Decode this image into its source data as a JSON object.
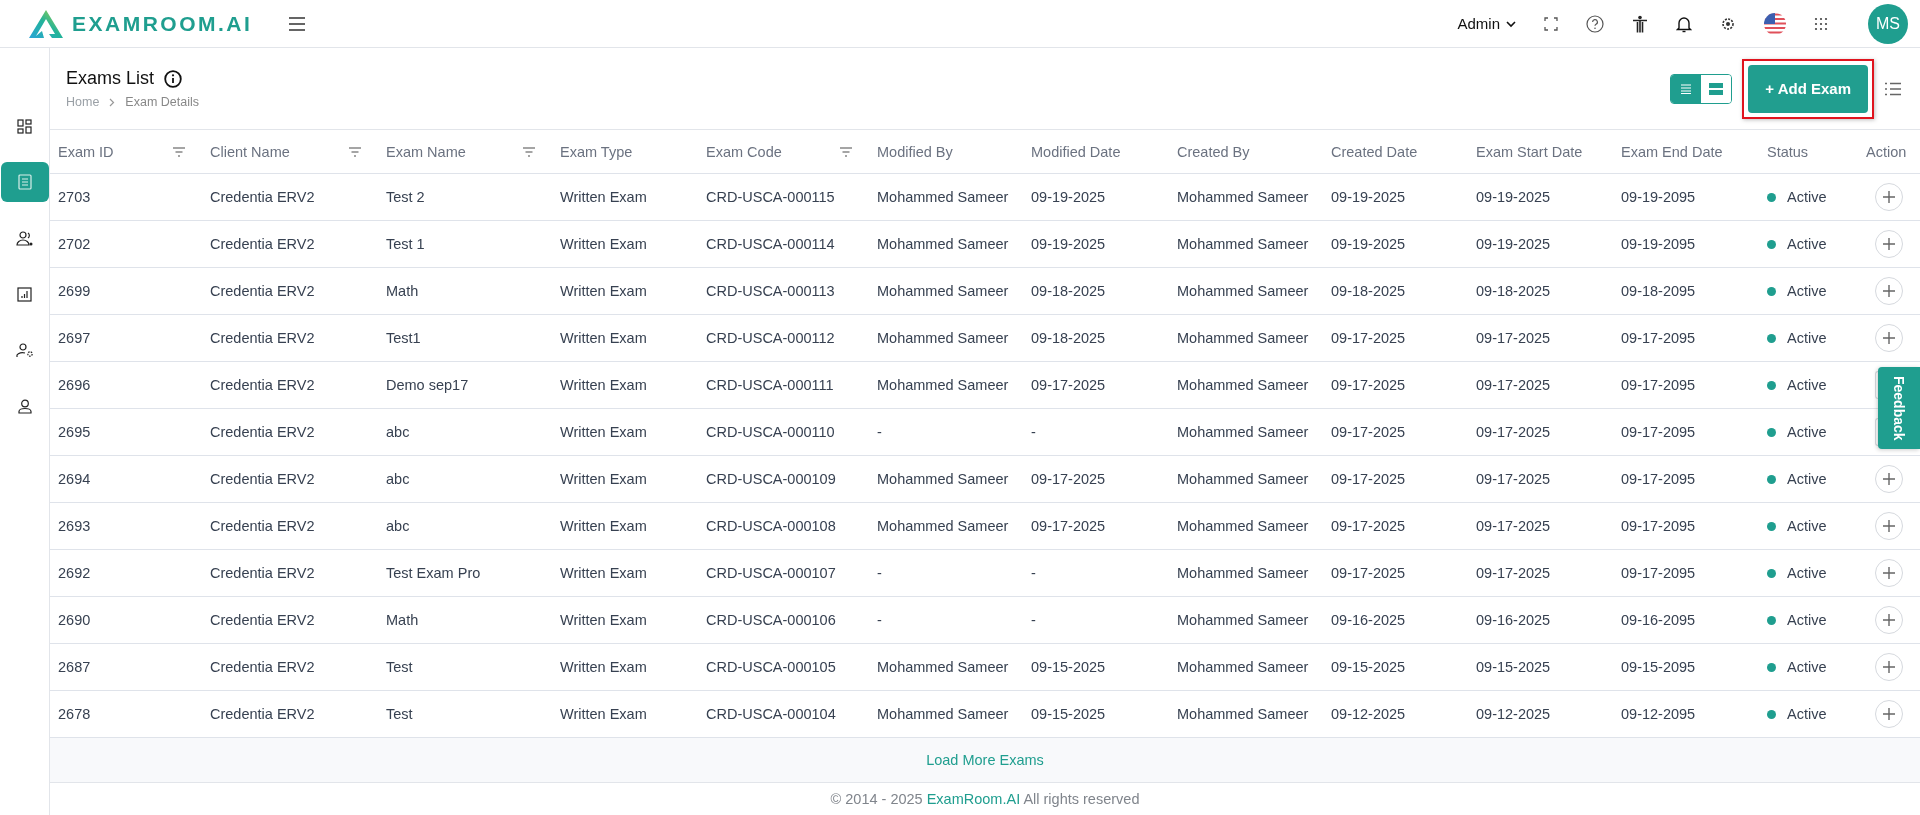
{
  "header": {
    "logo_text": "EXAMROOM.AI",
    "role": "Admin",
    "avatar": "MS"
  },
  "sidebar": {
    "items": [
      {
        "kind": "dashboard",
        "selected": false
      },
      {
        "kind": "exams",
        "selected": true
      },
      {
        "kind": "candidates",
        "selected": false
      },
      {
        "kind": "reports",
        "selected": false
      },
      {
        "kind": "user-settings",
        "selected": false
      },
      {
        "kind": "profile",
        "selected": false
      }
    ]
  },
  "page": {
    "title": "Exams List",
    "breadcrumb": [
      "Home",
      "Exam Details"
    ],
    "view_toggle": [
      {
        "kind": "list",
        "selected": true
      },
      {
        "kind": "cards",
        "selected": false
      }
    ],
    "add_button": {
      "label": "+ Add Exam",
      "highlighted": true
    }
  },
  "table": {
    "columns": [
      {
        "label": "Exam ID",
        "filter": true
      },
      {
        "label": "Client Name",
        "filter": true
      },
      {
        "label": "Exam Name",
        "filter": true
      },
      {
        "label": "Exam Type",
        "filter": false
      },
      {
        "label": "Exam Code",
        "filter": true
      },
      {
        "label": "Modified By",
        "filter": false
      },
      {
        "label": "Modified Date",
        "filter": false
      },
      {
        "label": "Created By",
        "filter": false
      },
      {
        "label": "Created Date",
        "filter": false
      },
      {
        "label": "Exam Start Date",
        "filter": false
      },
      {
        "label": "Exam End Date",
        "filter": false
      },
      {
        "label": "Status",
        "filter": false
      },
      {
        "label": "Action",
        "filter": false
      }
    ],
    "rows": [
      {
        "cells": [
          "2703",
          "Credentia ERV2",
          "Test 2",
          "Written Exam",
          "CRD-USCA-000115",
          "Mohammed Sameer",
          "09-19-2025",
          "Mohammed Sameer",
          "09-19-2025",
          "09-19-2025",
          "09-19-2095"
        ],
        "status": "Active",
        "color": "#1f9e8f"
      },
      {
        "cells": [
          "2702",
          "Credentia ERV2",
          "Test 1",
          "Written Exam",
          "CRD-USCA-000114",
          "Mohammed Sameer",
          "09-19-2025",
          "Mohammed Sameer",
          "09-19-2025",
          "09-19-2025",
          "09-19-2095"
        ],
        "status": "Active",
        "color": "#1f9e8f"
      },
      {
        "cells": [
          "2699",
          "Credentia ERV2",
          "Math",
          "Written Exam",
          "CRD-USCA-000113",
          "Mohammed Sameer",
          "09-18-2025",
          "Mohammed Sameer",
          "09-18-2025",
          "09-18-2025",
          "09-18-2095"
        ],
        "status": "Active",
        "color": "#1f9e8f"
      },
      {
        "cells": [
          "2697",
          "Credentia ERV2",
          "Test1",
          "Written Exam",
          "CRD-USCA-000112",
          "Mohammed Sameer",
          "09-18-2025",
          "Mohammed Sameer",
          "09-17-2025",
          "09-17-2025",
          "09-17-2095"
        ],
        "status": "Active",
        "color": "#1f9e8f"
      },
      {
        "cells": [
          "2696",
          "Credentia ERV2",
          "Demo sep17",
          "Written Exam",
          "CRD-USCA-000111",
          "Mohammed Sameer",
          "09-17-2025",
          "Mohammed Sameer",
          "09-17-2025",
          "09-17-2025",
          "09-17-2095"
        ],
        "status": "Active",
        "color": "#1f9e8f"
      },
      {
        "cells": [
          "2695",
          "Credentia ERV2",
          "abc",
          "Written Exam",
          "CRD-USCA-000110",
          "-",
          "-",
          "Mohammed Sameer",
          "09-17-2025",
          "09-17-2025",
          "09-17-2095"
        ],
        "status": "Active",
        "color": "#1f9e8f"
      },
      {
        "cells": [
          "2694",
          "Credentia ERV2",
          "abc",
          "Written Exam",
          "CRD-USCA-000109",
          "Mohammed Sameer",
          "09-17-2025",
          "Mohammed Sameer",
          "09-17-2025",
          "09-17-2025",
          "09-17-2095"
        ],
        "status": "Active",
        "color": "#1f9e8f"
      },
      {
        "cells": [
          "2693",
          "Credentia ERV2",
          "abc",
          "Written Exam",
          "CRD-USCA-000108",
          "Mohammed Sameer",
          "09-17-2025",
          "Mohammed Sameer",
          "09-17-2025",
          "09-17-2025",
          "09-17-2095"
        ],
        "status": "Active",
        "color": "#1f9e8f"
      },
      {
        "cells": [
          "2692",
          "Credentia ERV2",
          "Test Exam Pro",
          "Written Exam",
          "CRD-USCA-000107",
          "-",
          "-",
          "Mohammed Sameer",
          "09-17-2025",
          "09-17-2025",
          "09-17-2095"
        ],
        "status": "Active",
        "color": "#1f9e8f"
      },
      {
        "cells": [
          "2690",
          "Credentia ERV2",
          "Math",
          "Written Exam",
          "CRD-USCA-000106",
          "-",
          "-",
          "Mohammed Sameer",
          "09-16-2025",
          "09-16-2025",
          "09-16-2095"
        ],
        "status": "Active",
        "color": "#1f9e8f"
      },
      {
        "cells": [
          "2687",
          "Credentia ERV2",
          "Test",
          "Written Exam",
          "CRD-USCA-000105",
          "Mohammed Sameer",
          "09-15-2025",
          "Mohammed Sameer",
          "09-15-2025",
          "09-15-2025",
          "09-15-2095"
        ],
        "status": "Active",
        "color": "#1f9e8f"
      },
      {
        "cells": [
          "2678",
          "Credentia ERV2",
          "Test",
          "Written Exam",
          "CRD-USCA-000104",
          "Mohammed Sameer",
          "09-15-2025",
          "Mohammed Sameer",
          "09-12-2025",
          "09-12-2025",
          "09-12-2095"
        ],
        "status": "Active",
        "color": "#1f9e8f"
      }
    ],
    "load_more": "Load More Exams"
  },
  "feedback_tab": "Feedback",
  "footer": {
    "before": "© 2014 - 2025",
    "link": "ExamRoom.AI",
    "after": "All rights reserved"
  }
}
